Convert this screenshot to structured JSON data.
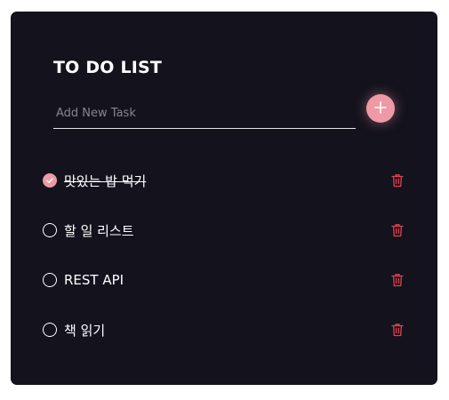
{
  "title": "TO DO LIST",
  "input": {
    "placeholder": "Add New Task",
    "value": ""
  },
  "colors": {
    "background": "#13121d",
    "accent": "#ee9aa6",
    "delete": "#e0434f",
    "text": "#ffffff"
  },
  "add_button": {
    "icon": "plus-icon"
  },
  "todos": [
    {
      "text": "맛있는 밥 먹기",
      "done": true
    },
    {
      "text": "할 일 리스트",
      "done": false
    },
    {
      "text": "REST API",
      "done": false
    },
    {
      "text": "책 읽기",
      "done": false
    }
  ],
  "item_icons": {
    "check": "check-icon",
    "delete": "trash-icon"
  }
}
